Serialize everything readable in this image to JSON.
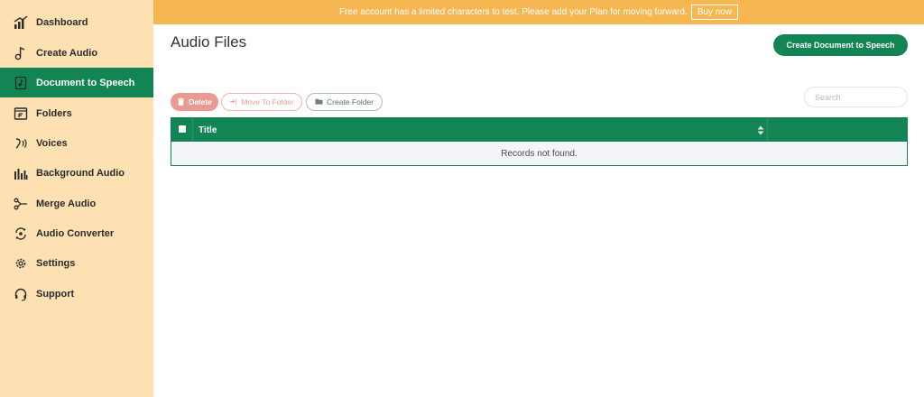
{
  "sidebar": {
    "items": [
      {
        "label": "Dashboard",
        "icon": "chart-bars-icon",
        "active": false
      },
      {
        "label": "Create Audio",
        "icon": "music-note-icon",
        "active": false
      },
      {
        "label": "Document to Speech",
        "icon": "document-audio-icon",
        "active": true
      },
      {
        "label": "Folders",
        "icon": "folder-icon",
        "active": false
      },
      {
        "label": "Voices",
        "icon": "voice-icon",
        "active": false
      },
      {
        "label": "Background Audio",
        "icon": "equalizer-icon",
        "active": false
      },
      {
        "label": "Merge Audio",
        "icon": "merge-icon",
        "active": false
      },
      {
        "label": "Audio Converter",
        "icon": "convert-icon",
        "active": false
      },
      {
        "label": "Settings",
        "icon": "gear-icon",
        "active": false
      },
      {
        "label": "Support",
        "icon": "headset-icon",
        "active": false
      }
    ]
  },
  "banner": {
    "message": "Free account has a limited characters to test. Please add your Plan for moving forward.",
    "buy_now": "Buy now"
  },
  "page": {
    "title": "Audio Files",
    "primary_action": "Create Document to Speech"
  },
  "toolbar": {
    "delete": "Delete",
    "move_to_folder": "Move To Folder",
    "create_folder": "Create Folder"
  },
  "search": {
    "placeholder": "Search",
    "value": ""
  },
  "table": {
    "columns": [
      "Title"
    ],
    "empty_message": "Records not found."
  },
  "colors": {
    "sidebar_bg": "#fde1b3",
    "accent_green": "#138555",
    "banner_orange": "#f6b752",
    "delete_red": "#e99a93"
  }
}
